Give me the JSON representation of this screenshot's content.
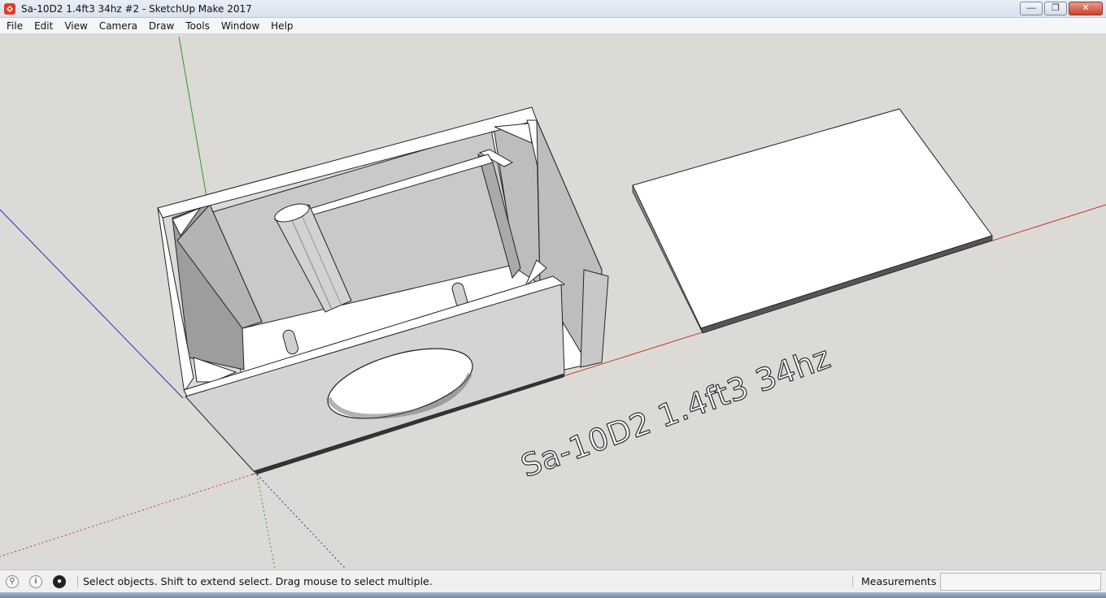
{
  "window": {
    "title": "Sa-10D2 1.4ft3 34hz #2 - SketchUp Make 2017",
    "app_icon": "sketchup-logo-icon",
    "controls": [
      "minimize-icon",
      "restore-icon",
      "close-icon"
    ]
  },
  "menu": [
    "File",
    "Edit",
    "View",
    "Camera",
    "Draw",
    "Tools",
    "Window",
    "Help"
  ],
  "viewport": {
    "model_label": "Sa-10D2 1.4ft3 34hz",
    "background": "#dcdad6",
    "axis_colors": {
      "red": "#c0392b",
      "green": "#2e9a2e",
      "blue": "#2c2cbf"
    }
  },
  "status": {
    "icons": [
      "geo-location-icon",
      "credits-icon",
      "user-account-icon"
    ],
    "hint": "Select objects. Shift to extend select. Drag mouse to select multiple.",
    "measurements_label": "Measurements",
    "measurements_value": ""
  }
}
